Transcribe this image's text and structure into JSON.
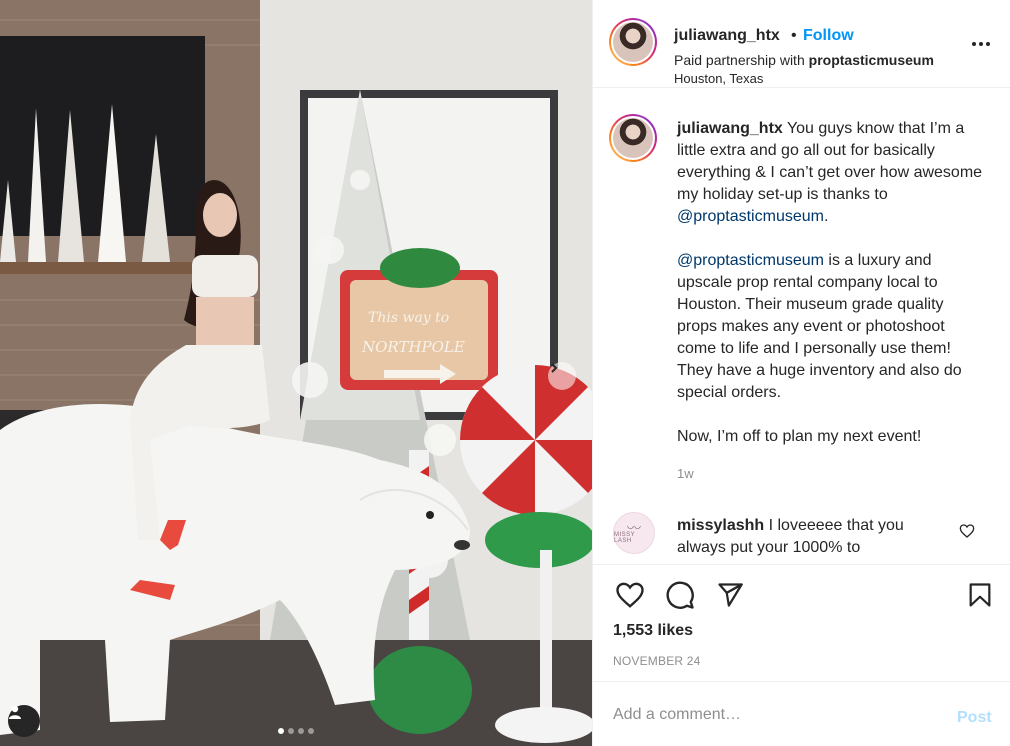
{
  "post": {
    "author": "juliawang_htx",
    "follow_label": "Follow",
    "separator": "•",
    "partnership_prefix": "Paid partnership with ",
    "partner": "proptasticmuseum",
    "location": "Houston, Texas",
    "caption": {
      "p1_text": " You guys know that I’m a little extra and go all out for basically everything & I can’t get over how awesome my holiday set-up is thanks to ",
      "p1_mention": "@proptasticmuseum",
      "p1_end": ".",
      "p2_mention": "@proptasticmuseum",
      "p2_text": " is a luxury and upscale prop rental company local to Houston. Their museum grade quality props makes any event or photoshoot come to life and I personally use them! They have a huge inventory and also do special orders.",
      "p3_text": "Now, I’m off to plan my next event!"
    },
    "caption_time": "1w",
    "likes": "1,553 likes",
    "date": "NOVEMBER 24"
  },
  "comment": {
    "user": "missylashh",
    "text": " I loveeeee that you always put your 1000% to",
    "avatar_brand": "MISSY LASH"
  },
  "composer": {
    "placeholder": "Add a comment…",
    "post_label": "Post"
  },
  "photo": {
    "sign_line1": "This way to",
    "sign_line2": "NORTHPOLE"
  },
  "carousel": {
    "total": 4,
    "current": 1
  },
  "icons": {
    "tag": "person-icon",
    "next": "chevron-right-icon",
    "more": "more-horizontal-icon",
    "like": "heart-icon",
    "comment": "comment-icon",
    "share": "paper-plane-icon",
    "save": "bookmark-icon"
  },
  "colors": {
    "accent": "#0095f6",
    "mention": "#00376b",
    "muted": "#8e8e8e",
    "post_disabled": "#b2dffc"
  }
}
